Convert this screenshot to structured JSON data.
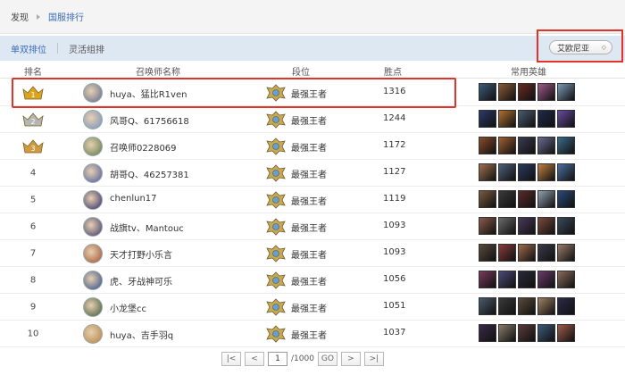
{
  "breadcrumb": {
    "root": "发现",
    "current": "国服排行"
  },
  "tabs": [
    {
      "label": "单双排位",
      "active": true
    },
    {
      "label": "灵活组排",
      "active": false
    }
  ],
  "server": {
    "selected": "艾欧尼亚",
    "caret": "◇"
  },
  "columns": {
    "rank": "排名",
    "name": "召唤师名称",
    "tier": "段位",
    "points": "胜点",
    "heroes": "常用英雄"
  },
  "accent_color": "#3a6bb8",
  "highlight_color": "#e0342b",
  "rows": [
    {
      "rank": "1",
      "name": "huya、猛比R1ven",
      "tier": "最强王者",
      "points": "1316",
      "avatar_color": "#5a6a90",
      "heroes": [
        "#3c5a78",
        "#8a5a34",
        "#6a2a22",
        "#a05a8a",
        "#7a9ab8"
      ]
    },
    {
      "rank": "2",
      "name": "风哥Q、61756618",
      "tier": "最强王者",
      "points": "1244",
      "avatar_color": "#6f8fc0",
      "heroes": [
        "#2a3a6a",
        "#b07030",
        "#4a5a70",
        "#1e2a4a",
        "#6a4aa0"
      ]
    },
    {
      "rank": "3",
      "name": "召唤师0228069",
      "tier": "最强王者",
      "points": "1172",
      "avatar_color": "#5a7a4a",
      "heroes": [
        "#8a4a2a",
        "#a06030",
        "#3a3a50",
        "#6a6a90",
        "#3a6a8a"
      ]
    },
    {
      "rank": "4",
      "name": "胡哥Q、46257381",
      "tier": "最强王者",
      "points": "1127",
      "avatar_color": "#4a5aa0",
      "heroes": [
        "#a07050",
        "#50607a",
        "#2a3a60",
        "#c08040",
        "#4a70a0"
      ]
    },
    {
      "rank": "5",
      "name": "chenlun17",
      "tier": "最强王者",
      "points": "1119",
      "avatar_color": "#2a2a6a",
      "heroes": [
        "#7a5a40",
        "#3a3a3a",
        "#5a2a2a",
        "#90a0b0",
        "#2a4a7a"
      ]
    },
    {
      "rank": "6",
      "name": "战旗tv、Mantouc",
      "tier": "最强王者",
      "points": "1093",
      "avatar_color": "#3a3a70",
      "heroes": [
        "#8a5a4a",
        "#6a6a6a",
        "#4a3a5a",
        "#7a4a3a",
        "#3a4a5a"
      ]
    },
    {
      "rank": "7",
      "name": "天才打野小乐言",
      "tier": "最强王者",
      "points": "1093",
      "avatar_color": "#a05030",
      "heroes": [
        "#5a4a3a",
        "#8a3a3a",
        "#a06a4a",
        "#3a3a4a",
        "#9a7a6a"
      ]
    },
    {
      "rank": "8",
      "name": "虎、牙战神可乐",
      "tier": "最强王者",
      "points": "1056",
      "avatar_color": "#2a4a8a",
      "heroes": [
        "#7a3a5a",
        "#4a4a7a",
        "#2a2a3a",
        "#6a3a6a",
        "#8a6a5a"
      ]
    },
    {
      "rank": "9",
      "name": "小龙堡cc",
      "tier": "最强王者",
      "points": "1051",
      "avatar_color": "#3a5a3a",
      "heroes": [
        "#4a5a6a",
        "#3a3a3a",
        "#5a4a3a",
        "#a08060",
        "#2a2a4a"
      ]
    },
    {
      "rank": "10",
      "name": "huya、吉手羽q",
      "tier": "最强王者",
      "points": "1037",
      "avatar_color": "#b08040",
      "heroes": [
        "#3a2a4a",
        "#8a7a6a",
        "#5a3a3a",
        "#3a5a7a",
        "#a05a4a"
      ]
    }
  ],
  "pager": {
    "first": "|<",
    "prev": "<",
    "current_page": "1",
    "total": "/1000",
    "go": "GO",
    "next": ">",
    "last": ">|"
  }
}
